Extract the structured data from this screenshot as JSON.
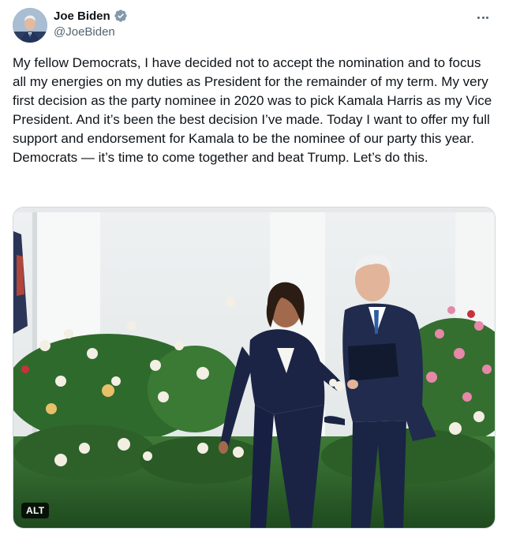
{
  "author": {
    "display_name": "Joe Biden",
    "handle": "@JoeBiden",
    "verified_icon": "verified-badge-icon",
    "avatar_icon": "avatar-photo"
  },
  "tweet": {
    "text": "My fellow Democrats, I have decided not to accept the nomination and to focus all my energies on my duties as President for the remainder of my term. My very first decision as the party nominee in 2020 was to pick Kamala Harris as my Vice President. And it’s been the best decision I’ve made. Today I want to offer my full support and endorsement for Kamala to be the nominee of our party this year. Democrats — it’s time to come together and beat Trump. Let’s do this."
  },
  "media": {
    "alt_label": "ALT"
  },
  "colors": {
    "text_primary": "#0f1419",
    "text_secondary": "#536471",
    "verified_blue": "#1d9bf0",
    "border": "#cfd9de"
  }
}
